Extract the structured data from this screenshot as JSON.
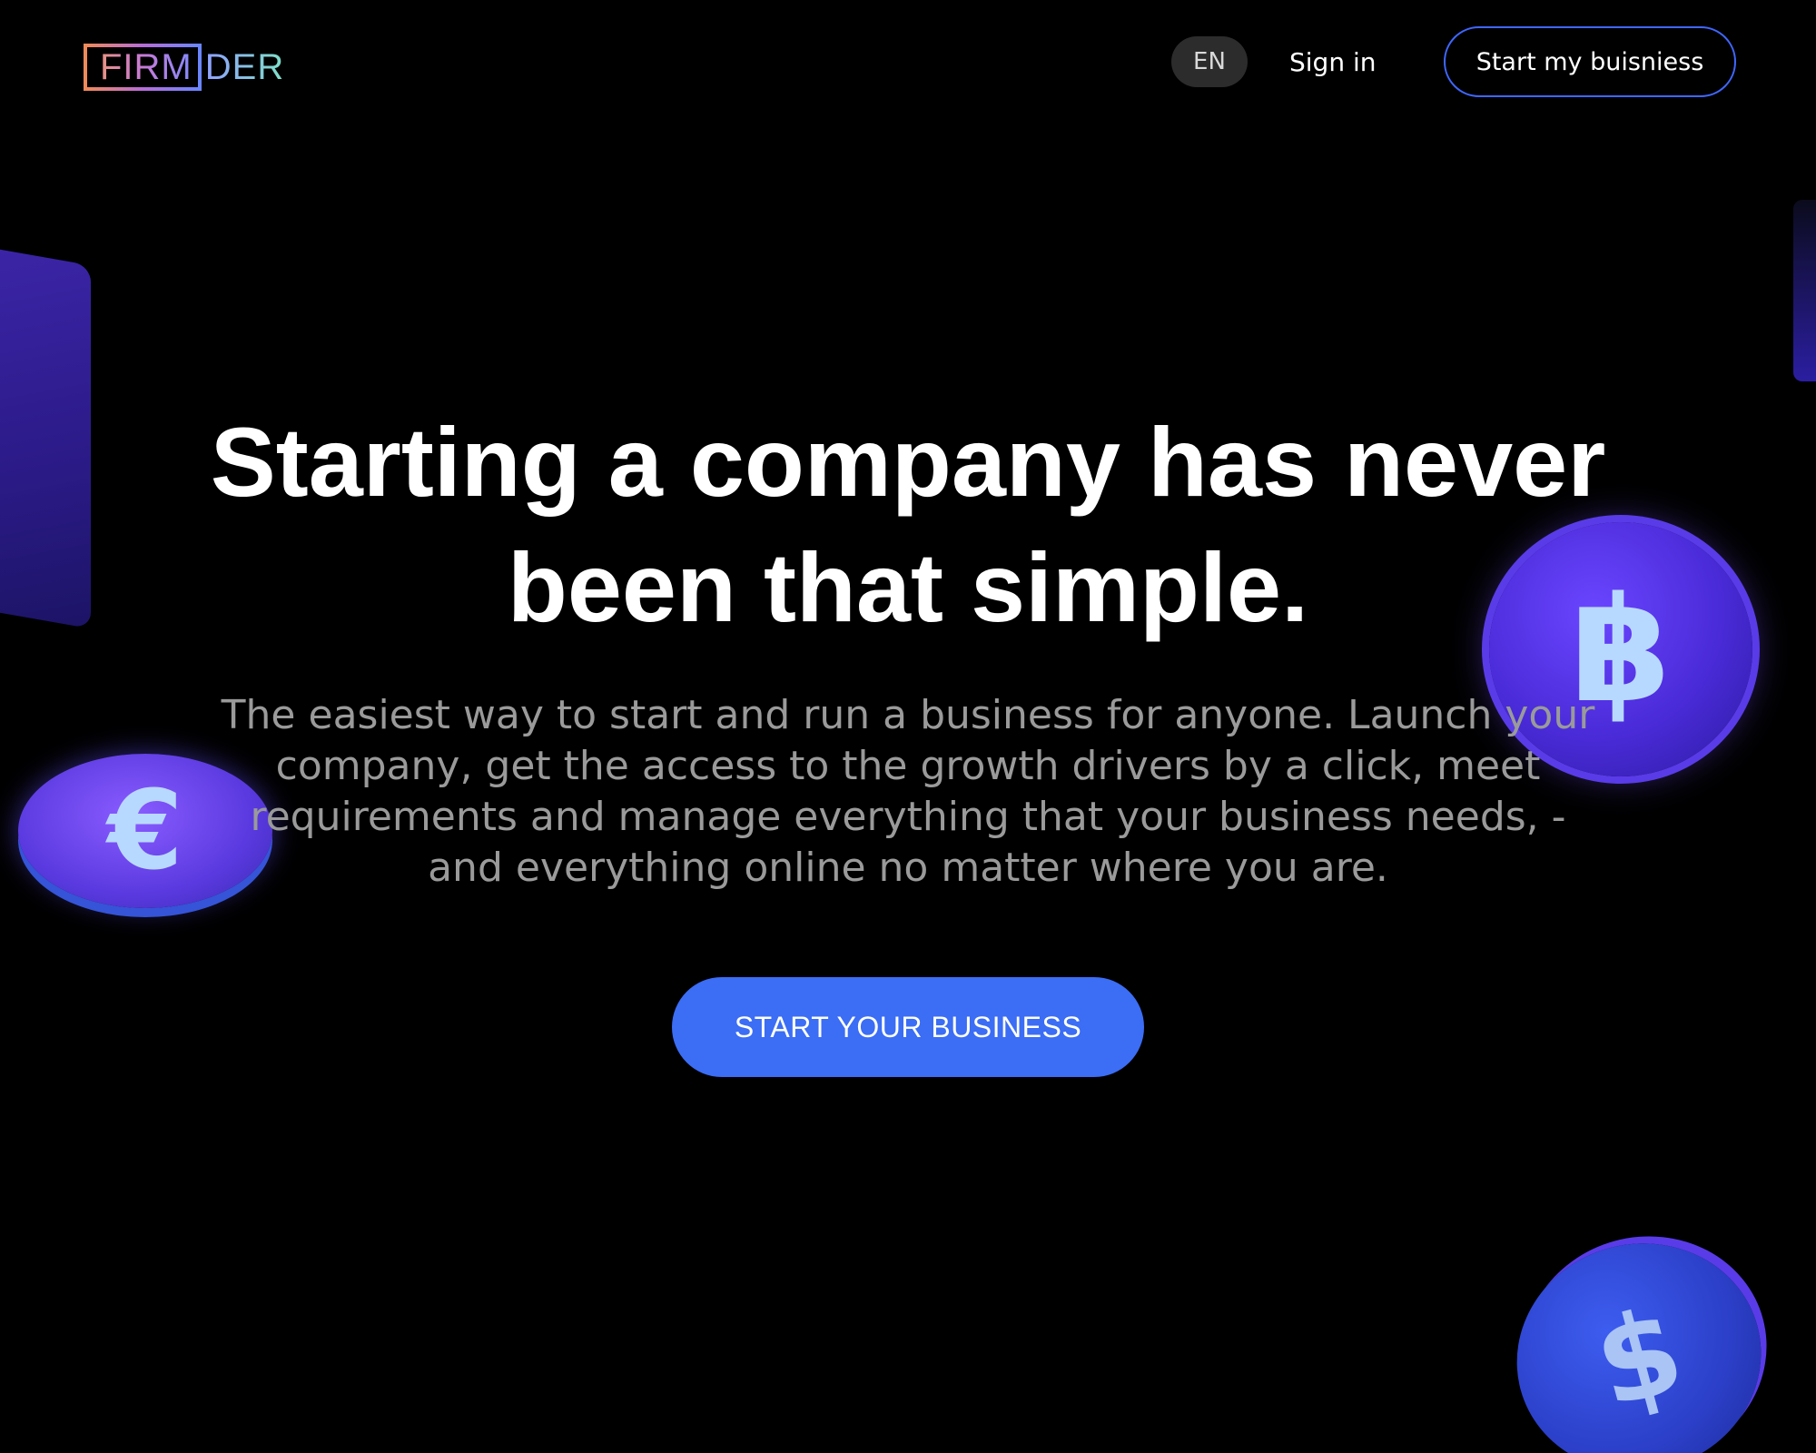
{
  "header": {
    "logo_left": "FIRM",
    "logo_right": "DER",
    "lang": "EN",
    "signin_label": "Sign in",
    "start_my_label": "Start my buisniess"
  },
  "hero": {
    "title_line1": "Starting a company has never",
    "title_line2": "been that simple.",
    "subtitle": "The easiest way to start and run a business for anyone. Launch your company, get the access to the growth drivers by a click, meet requirements and manage everything that your business needs, - and everything online no matter where you are.",
    "cta_label": "START YOUR BUSINESS"
  },
  "decor": {
    "coins": [
      {
        "icon": "baht-coin-icon",
        "glyph": "฿"
      },
      {
        "icon": "euro-coin-icon",
        "glyph": "€"
      },
      {
        "icon": "dollar-coin-icon",
        "glyph": "$"
      }
    ]
  },
  "colors": {
    "background": "#000000",
    "accent": "#3b6df5",
    "outline_accent": "#3f67ff",
    "subtitle_text": "#9a9a9a"
  }
}
